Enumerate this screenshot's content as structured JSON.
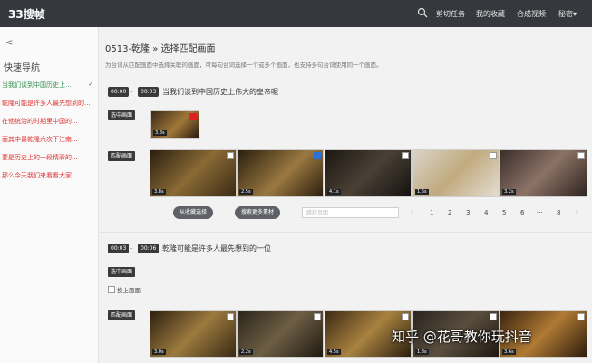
{
  "header": {
    "logo": "33搜帧",
    "search_icon": "search-icon",
    "nav": [
      "剪切任务",
      "我的收藏",
      "合成视频",
      "秘密"
    ],
    "menu_chevron": "▾"
  },
  "sidebar": {
    "back": "<",
    "title": "快速导航",
    "check_mark": "✓",
    "items": [
      {
        "label": "当我们谈到中国历史上...",
        "active": true
      },
      {
        "label": "乾隆可能是许多人最先想到的..."
      },
      {
        "label": "在他统治的时期里中国的..."
      },
      {
        "label": "而其中最乾隆六次下江南..."
      },
      {
        "label": "要是历史上的一段精彩的..."
      },
      {
        "label": "那么今天我们来看看大家..."
      }
    ]
  },
  "main": {
    "title": "0513-乾隆 » 选择匹配画面",
    "subtitle": "为台词从匹配画面中选择关联的画面，可每句台词选择一个或多个画面，也支持多句台词使用同一个画面。",
    "pagination": {
      "input_placeholder": "跳转页面",
      "prev": "‹",
      "pages": [
        "1",
        "2",
        "3",
        "4",
        "5",
        "6",
        "···",
        "8"
      ],
      "active_page": "1",
      "next": "›"
    },
    "sentences": [
      {
        "start": "00:00",
        "dash": "–",
        "end": "00:03",
        "text": "当我们谈到中国历史上伟大的皇帝呢",
        "selected_tag": "选中画面",
        "selected_badge": "3.8s",
        "match_tag": "匹配画面",
        "match_badges": [
          "3.8s",
          "2.5s",
          "4.1s",
          "1.6s",
          "3.2s"
        ],
        "fill_button": "从收藏选择",
        "search_button": "搜索更多素材"
      },
      {
        "start": "00:03",
        "dash": "–",
        "end": "00:06",
        "text": "乾隆可能是许多人最先想到的一位",
        "selected_tag": "选中画面",
        "replace_label": "换上面面",
        "match_tag": "匹配画面",
        "match_badges": [
          "3.0s",
          "2.2s",
          "4.5s",
          "1.8s",
          "3.6s"
        ]
      }
    ]
  },
  "watermark": "知乎 @花哥教你玩抖音",
  "colors": {
    "topbar": "#35393e",
    "accent": "#2f6fd8",
    "tag": "#3a3a3a",
    "sidebar_link": "#d33",
    "sidebar_active": "#2f8f4a"
  }
}
